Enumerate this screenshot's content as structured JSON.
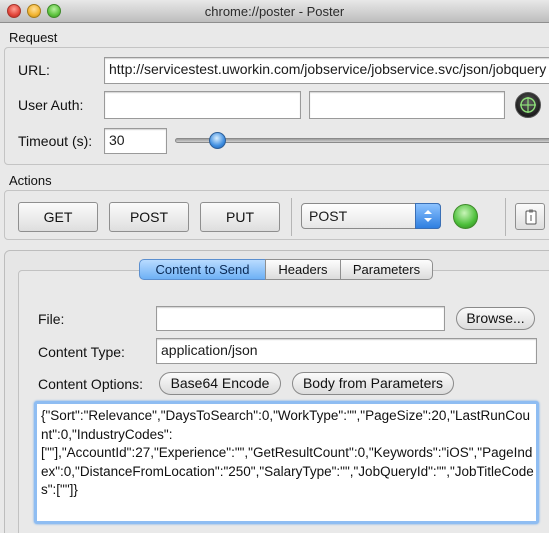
{
  "window": {
    "title": "chrome://poster - Poster"
  },
  "request": {
    "section_label": "Request",
    "url_label": "URL:",
    "url_value": "http://servicestest.uworkin.com/jobservice/jobservice.svc/json/jobquery",
    "user_auth_label": "User Auth:",
    "user_auth_user": "",
    "user_auth_password": "",
    "timeout_label": "Timeout (s):",
    "timeout_value": "30",
    "timeout_slider_fraction": 0.11
  },
  "actions": {
    "section_label": "Actions",
    "get_label": "GET",
    "post_label": "POST",
    "put_label": "PUT",
    "method_selected": "POST",
    "status_color": "#4cbf3a"
  },
  "content": {
    "tabs": [
      {
        "label": "Content to Send",
        "active": true
      },
      {
        "label": "Headers",
        "active": false
      },
      {
        "label": "Parameters",
        "active": false
      }
    ],
    "file_label": "File:",
    "file_value": "",
    "browse_label": "Browse...",
    "content_type_label": "Content Type:",
    "content_type_value": "application/json",
    "content_options_label": "Content Options:",
    "base64_label": "Base64 Encode",
    "body_from_params_label": "Body from Parameters",
    "body_text": "{\"Sort\":\"Relevance\",\"DaysToSearch\":0,\"WorkType\":\"\",\"PageSize\":20,\"LastRunCount\":0,\"IndustryCodes\":\n[\"\"],\"AccountId\":27,\"Experience\":\"\",\"GetResultCount\":0,\"Keywords\":\"iOS\",\"PageIndex\":0,\"DistanceFromLocation\":\"250\",\"SalaryType\":\"\",\"JobQueryId\":\"\",\"JobTitleCodes\":[\"\"]}"
  }
}
